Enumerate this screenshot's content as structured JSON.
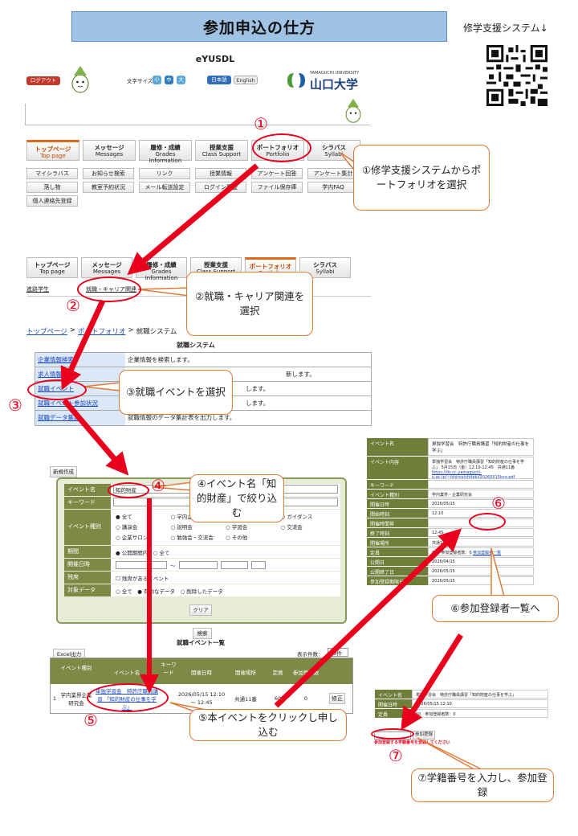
{
  "title": "参加申込の仕方",
  "qr_label": "修学支援システム↓",
  "portal": {
    "logo": "eYUSDL",
    "logout": "ログアウト",
    "font_size_label": "文字サイズ",
    "font_sizes": [
      "小",
      "中",
      "大"
    ],
    "lang_ja": "日本語",
    "lang_en": "English",
    "univ_name": "山口大学",
    "univ_name_en": "YAMAGUCHI UNIVERSITY",
    "tabs": [
      {
        "ja": "トップページ",
        "en": "Top page"
      },
      {
        "ja": "メッセージ",
        "en": "Messages"
      },
      {
        "ja": "履修・成績",
        "en": "Grades Information"
      },
      {
        "ja": "授業支援",
        "en": "Class Support"
      },
      {
        "ja": "ポートフォリオ",
        "en": "Portfolio"
      },
      {
        "ja": "シラバス",
        "en": "Syllabi"
      }
    ],
    "sub_row1": [
      "マイシラバス",
      "お知らせ検索",
      "リンク",
      "授業情報",
      "アンケート回答",
      "アンケート集計"
    ],
    "sub_row2": [
      "落し物",
      "教室予約状況",
      "メール転送設定",
      "ログイン履歴",
      "ファイル保存庫",
      "学内FAQ"
    ],
    "sub_row3": [
      "個人連絡先登録"
    ],
    "tabs2_sub": [
      "進路学生",
      "就職・キャリア関連"
    ]
  },
  "breadcrumb": {
    "top": "トップページ",
    "portfolio": "ポートフォリオ",
    "current": "就職システム",
    "sep": ">"
  },
  "job_system": {
    "heading": "就職システム",
    "rows": [
      {
        "link": "企業情報検索",
        "desc": "企業情報を検索します。"
      },
      {
        "link": "求人情報検索",
        "desc": "新します。"
      },
      {
        "link": "就職イベント",
        "desc": "します。"
      },
      {
        "link": "就職イベント参加状況",
        "desc": "します。"
      },
      {
        "link": "就職データ集計",
        "desc": "就職情報のデータ集計表を出力します。"
      }
    ]
  },
  "search_form": {
    "new_button": "新規作成",
    "event_name_label": "イベント名",
    "event_name_value": "知的財産",
    "keyword_label": "キーワード",
    "type_label": "イベント種別",
    "types": [
      "全て",
      "学内企業説明",
      "講演会",
      "説明会",
      "学習会",
      "交流会",
      "企業サロン",
      "勉強会・交流会",
      "その他",
      "ガイダンス"
    ],
    "period_label": "期間",
    "period_options": [
      "公開期間内",
      "全て"
    ],
    "date_label": "開催日時",
    "date_sep": "～",
    "attach_label": "残席",
    "attach_option": "残席があるイベント",
    "target_label": "対象データ",
    "target_options": [
      "全て",
      "有効なデータ",
      "削除したデータ"
    ],
    "clear_button": "クリア",
    "search_button": "検索"
  },
  "event_list": {
    "heading": "就職イベント一覧",
    "excel_button": "Excel出力",
    "count_label": "表示件数：",
    "count_value": "30件",
    "columns": [
      "イベント種別",
      "イベント名",
      "キーワード",
      "開催日時",
      "開催場所",
      "定員",
      "参加登録数",
      ""
    ],
    "row": {
      "no": "1",
      "type": "学内業界企業研究会",
      "name": "単独学習会　特許庁職員講習 「知的財産の仕事を学ぶ」",
      "date": "2026/05/15 12:10 ～ 12:45",
      "place": "共通11番",
      "capacity": "60",
      "registered": "0",
      "edit": "修正"
    }
  },
  "detail_panel": {
    "rows": [
      {
        "label": "イベント名",
        "value": "単独学習会　特許庁職員講習「知的財産の仕事を学ぶ」"
      },
      {
        "label": "イベント内容",
        "value": "単独学習会　特許庁職員講習「知的財産の仕事を学ぶ」 5月15日（金）12:10-12:45　共通11番"
      },
      {
        "label": "イベントURL",
        "value": "https://ds.cc.yamaguchi-u.ac.jp/~/shiryo/chiteki/20260515kyo.pdf"
      },
      {
        "label": "キーワード",
        "value": ""
      },
      {
        "label": "イベント種別",
        "value": "学内業界・企業研究会"
      },
      {
        "label": "開催日時",
        "value": "2026/05/15"
      },
      {
        "label": "開始時刻",
        "value": "12:10"
      },
      {
        "label": "開催時間帯",
        "value": ""
      },
      {
        "label": "終了時刻",
        "value": "12:45"
      },
      {
        "label": "開催場所",
        "value": "共通11番"
      },
      {
        "label": "定員",
        "value": "60　参加登録者数：0"
      },
      {
        "label": "公開日",
        "value": "2026/04/15"
      },
      {
        "label": "公開終了日",
        "value": "2026/05/15"
      },
      {
        "label": "参加登録期限日",
        "value": "2026/05/15"
      }
    ],
    "list_link": "参加登録者一覧"
  },
  "register_panel": {
    "rows": [
      {
        "label": "イベント名",
        "value": "単独学習会　特許庁職員講習「知的財産の仕事を学ぶ」"
      },
      {
        "label": "開催日時",
        "value": "2026/05/15 12:10"
      },
      {
        "label": "定員",
        "value": "60　参加登録者数：0"
      }
    ],
    "register_button": "参加登録",
    "warning": "参加登録する学籍番号を登録してください"
  },
  "callouts": {
    "c1": "①修学支援システムからポートフォリオを選択",
    "c2": "②就職・キャリア関連を選択",
    "c3": "③就職イベントを選択",
    "c4": "④イベント名「知的財産」で絞り込む",
    "c5": "⑤本イベントをクリックし申し込む",
    "c6": "⑥参加登録者一覧へ",
    "c7": "⑦学籍番号を入力し、参加登録"
  },
  "step_numbers": [
    "①",
    "②",
    "③",
    "④",
    "⑤",
    "⑥",
    "⑦"
  ],
  "colors": {
    "arrow": "#e8001c",
    "callout_border": "#e07b39",
    "title_bg": "#9fc3e5",
    "panel_green": "#6f7f3a"
  },
  "icons": [
    "mascot-icon",
    "qr-code-icon",
    "university-logo-icon"
  ]
}
